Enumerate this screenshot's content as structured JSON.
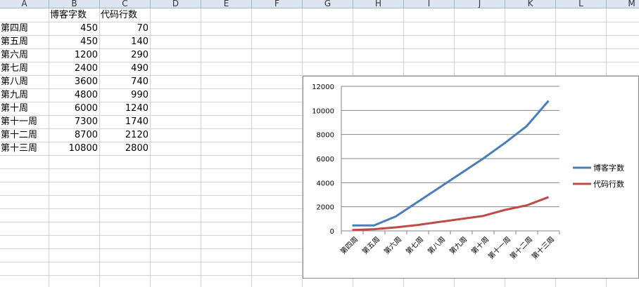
{
  "columns": [
    "A",
    "B",
    "C",
    "D",
    "E",
    "F",
    "G",
    "H",
    "I",
    "J",
    "K",
    "L",
    "M"
  ],
  "table": {
    "header": [
      "",
      "博客字数",
      "代码行数"
    ],
    "rows": [
      [
        "第四周",
        "450",
        "70"
      ],
      [
        "第五周",
        "450",
        "140"
      ],
      [
        "第六周",
        "1200",
        "290"
      ],
      [
        "第七周",
        "2400",
        "490"
      ],
      [
        "第八周",
        "3600",
        "740"
      ],
      [
        "第九周",
        "4800",
        "990"
      ],
      [
        "第十周",
        "6000",
        "1240"
      ],
      [
        "第十一周",
        "7300",
        "1740"
      ],
      [
        "第十二周",
        "8700",
        "2120"
      ],
      [
        "第十三周",
        "10800",
        "2800"
      ]
    ]
  },
  "chart_data": {
    "type": "line",
    "categories": [
      "第四周",
      "第五周",
      "第六周",
      "第七周",
      "第八周",
      "第九周",
      "第十周",
      "第十一周",
      "第十二周",
      "第十三周"
    ],
    "series": [
      {
        "name": "博客字数",
        "color": "#4a7ebb",
        "values": [
          450,
          450,
          1200,
          2400,
          3600,
          4800,
          6000,
          7300,
          8700,
          10800
        ]
      },
      {
        "name": "代码行数",
        "color": "#be4b48",
        "values": [
          70,
          140,
          290,
          490,
          740,
          990,
          1240,
          1740,
          2120,
          2800
        ]
      }
    ],
    "ylim": [
      0,
      12000
    ],
    "yticks": [
      "0",
      "2000",
      "4000",
      "6000",
      "8000",
      "10000",
      "12000"
    ],
    "grid": true,
    "legend": "right"
  }
}
